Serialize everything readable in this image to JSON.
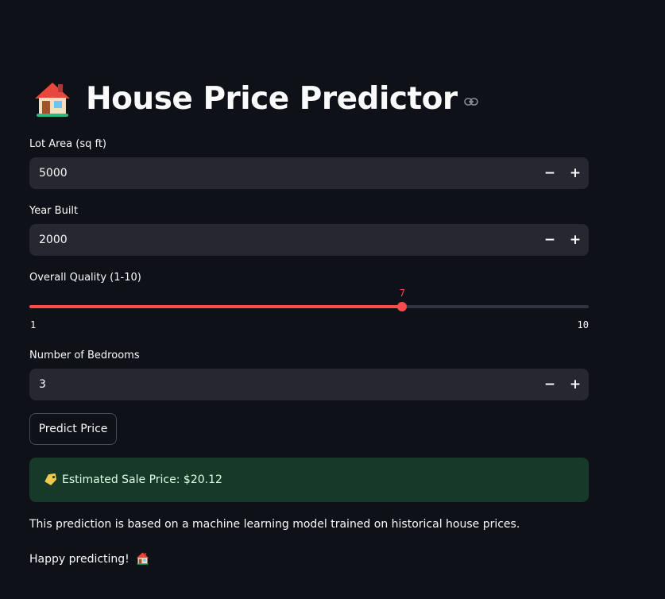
{
  "header": {
    "title": "House Price Predictor",
    "title_icon": "house-emoji",
    "anchor_icon": "link-icon"
  },
  "fields": {
    "lot_area": {
      "label": "Lot Area (sq ft)",
      "value": "5000"
    },
    "year_built": {
      "label": "Year Built",
      "value": "2000"
    },
    "bedrooms": {
      "label": "Number of Bedrooms",
      "value": "3"
    }
  },
  "quality_slider": {
    "label": "Overall Quality (1-10)",
    "value": 7,
    "value_text": "7",
    "min_text": "1",
    "max_text": "10"
  },
  "stepper": {
    "minus": "−",
    "plus": "+"
  },
  "predict_button": {
    "label": "Predict Price"
  },
  "result": {
    "icon": "price-tag-icon",
    "text": "Estimated Sale Price: $20.12"
  },
  "info_text": "This prediction is based on a machine learning model trained on historical house prices.",
  "footer_text": "Happy predicting!",
  "colors": {
    "background": "#0e1117",
    "input_background": "#262730",
    "accent": "#ff4b4b",
    "success_background": "#173928"
  }
}
